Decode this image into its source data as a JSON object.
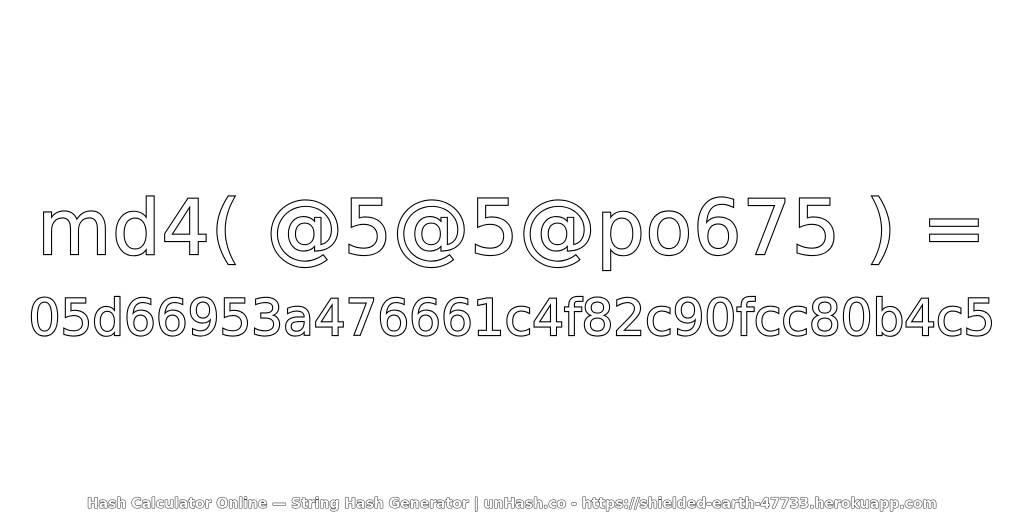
{
  "main": {
    "expression": "md4( @5@5@po675 ) =",
    "hash": "05d66953a476661c4f82c90fcc80b4c5"
  },
  "footer": {
    "text": "Hash Calculator Online — String Hash Generator | unHash.co - https://shielded-earth-47733.herokuapp.com"
  },
  "colors": {
    "background": "#ffffff",
    "text_fill": "#ffffff",
    "text_outline": "#000000"
  }
}
